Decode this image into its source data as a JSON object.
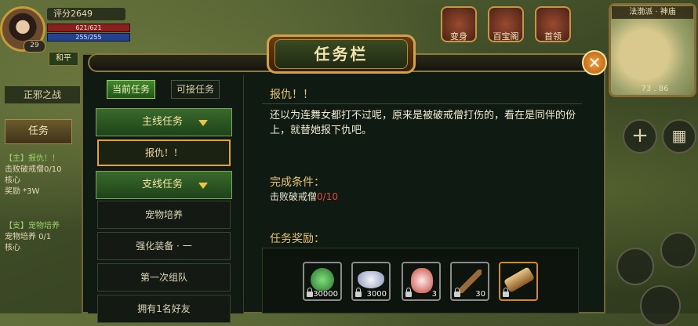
{
  "hud": {
    "score": "评分2649",
    "level": "29",
    "hp": "621/621",
    "mp": "255/255",
    "peace": "和平",
    "faction_war": "正邪之战",
    "quest_tab": "任务",
    "side_quests": [
      {
        "line1": "【主】报仇！！",
        "line2": "击败破戒僧0/10",
        "line3": "核心",
        "line4": "奖励  *3W"
      },
      {
        "line1": "【支】宠物培养",
        "line2": "宠物培养 0/1",
        "line3": "核心"
      }
    ],
    "top_buttons": [
      "变身",
      "百宝阁",
      "首领"
    ],
    "map_name": "法渤派 · 神庙",
    "map_coord": "73 . 86",
    "plus_icon": "+",
    "grid_icon": "▦"
  },
  "dialog": {
    "title": "任务栏",
    "close_label": "✕",
    "tabs": {
      "current": "当前任务",
      "available": "可接任务"
    },
    "categories": {
      "main": "主线任务",
      "branch": "支线任务"
    },
    "main_tasks": [
      "报仇！！"
    ],
    "branch_tasks": [
      "宠物培养",
      "强化装备 · 一",
      "第一次组队",
      "拥有1名好友"
    ],
    "quest": {
      "name": "报仇！！",
      "description": "还以为连舞女都打不过呢，原来是被破戒僧打伤的，看在是同伴的份上，就替她报下仇吧。",
      "cond_title": "完成条件：",
      "cond_text": "击败破戒僧",
      "cond_count": "0/10",
      "reward_title": "任务奖励：",
      "rewards": [
        {
          "icon": "exp-icon",
          "qty": "30000",
          "color": "#2e7a3a"
        },
        {
          "icon": "silver-ingot-icon",
          "qty": "3000",
          "color": "#3b5a9a"
        },
        {
          "icon": "red-bag-icon",
          "qty": "3",
          "color": "#7a3a5a"
        },
        {
          "icon": "wood-bow-icon",
          "qty": "30",
          "color": "#4a5a3a"
        },
        {
          "icon": "scroll-icon",
          "qty": "",
          "color": "#6a4a20"
        }
      ]
    }
  }
}
